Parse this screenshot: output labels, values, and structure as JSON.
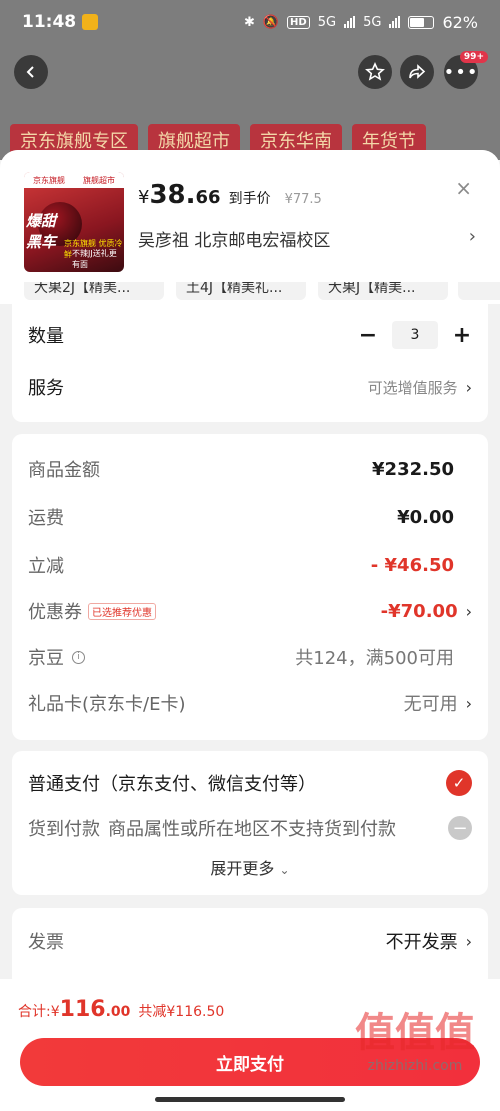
{
  "status_bar": {
    "time": "11:48",
    "hd": "HD",
    "net1": "5G",
    "net2": "5G",
    "battery": "62%",
    "battery_level": 0.62
  },
  "nav": {
    "badge": "99+",
    "back_icon": "back-icon",
    "star_icon": "star-icon",
    "share_icon": "share-icon",
    "more_icon": "more-icon"
  },
  "banner": {
    "items": [
      "京东旗舰专区",
      "旗舰超市",
      "京东华南",
      "年货节"
    ]
  },
  "product": {
    "thumb_top_left": "京东旗舰",
    "thumb_top_right": "旗舰超市",
    "thumb_label_a": "爆甜",
    "thumb_label_a2": "黑车",
    "thumb_label_b": "京东旗舰 优质冷鲜",
    "thumb_label_c": "不辣JJ送礼更有面",
    "price_symbol": "¥",
    "price_int": "38.",
    "price_dec": "66",
    "price_tag": "到手价",
    "price_old": "¥77.5",
    "close": "×",
    "address": "吴彦祖  北京邮电宏福校区",
    "chevron": "›"
  },
  "variants": [
    "大果2J【精美...",
    "土4J【精美礼...",
    "大果J【精美..."
  ],
  "quantity": {
    "label": "数量",
    "minus": "−",
    "value": "3",
    "plus": "+"
  },
  "service": {
    "label": "服务",
    "value": "可选增值服务",
    "chevron": "›"
  },
  "amounts": {
    "goods_label": "商品金额",
    "goods_value": "¥232.50",
    "shipping_label": "运费",
    "shipping_value": "¥0.00",
    "discount_label": "立减",
    "discount_value": "- ¥46.50",
    "coupon_label": "优惠券",
    "coupon_tag": "已选推荐优惠",
    "coupon_value": "-¥70.00",
    "jd_bean_label": "京豆",
    "jd_bean_value": "共124，满500可用",
    "giftcard_label": "礼品卡(京东卡/E卡)",
    "giftcard_value": "无可用",
    "chevron": "›",
    "info": "i"
  },
  "payment": {
    "normal_label": "普通支付（京东支付、微信支付等）",
    "cod_label": "货到付款",
    "cod_note": "商品属性或所在地区不支持货到付款",
    "expand": "展开更多",
    "expand_chev": "⌄",
    "check": "✓",
    "disabled": "−"
  },
  "invoice": {
    "label": "发票",
    "value": "不开发票",
    "chevron": "›"
  },
  "footer": {
    "total_label": "合计: ",
    "total_symbol": "¥",
    "total_int": "116",
    "total_dec": ".00",
    "total_save": "共减¥116.50",
    "pay_button": "立即支付"
  },
  "watermark": {
    "logo": "值值值",
    "site": "zhizhizhi.com"
  }
}
